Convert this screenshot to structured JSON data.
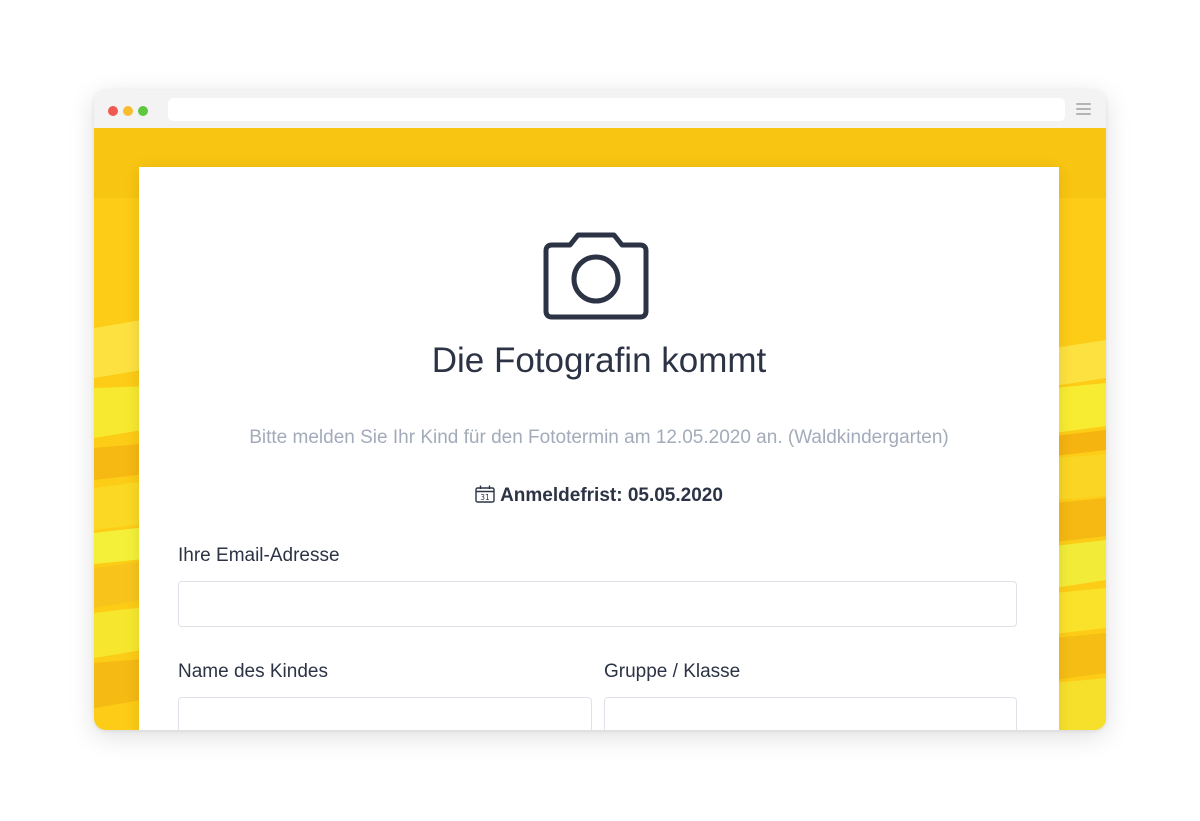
{
  "browser": {
    "address_value": ""
  },
  "form": {
    "title": "Die Fotografin kommt",
    "subtitle": "Bitte melden Sie Ihr Kind für den Fototermin am 12.05.2020 an. (Waldkindergarten)",
    "deadline": "Anmeldefrist: 05.05.2020",
    "calendar_day": "31",
    "fields": {
      "email": {
        "label": "Ihre Email-Adresse",
        "value": ""
      },
      "child_name": {
        "label": "Name des Kindes",
        "value": ""
      },
      "group": {
        "label": "Gruppe / Klasse",
        "value": ""
      }
    }
  },
  "icons": {
    "header": "camera-icon",
    "deadline": "calendar-icon",
    "menu": "hamburger-menu-icon"
  },
  "colors": {
    "background": "#fccc16",
    "text_primary": "#2c3345",
    "text_muted": "#a3abba",
    "field_border": "#dfe2e8"
  }
}
